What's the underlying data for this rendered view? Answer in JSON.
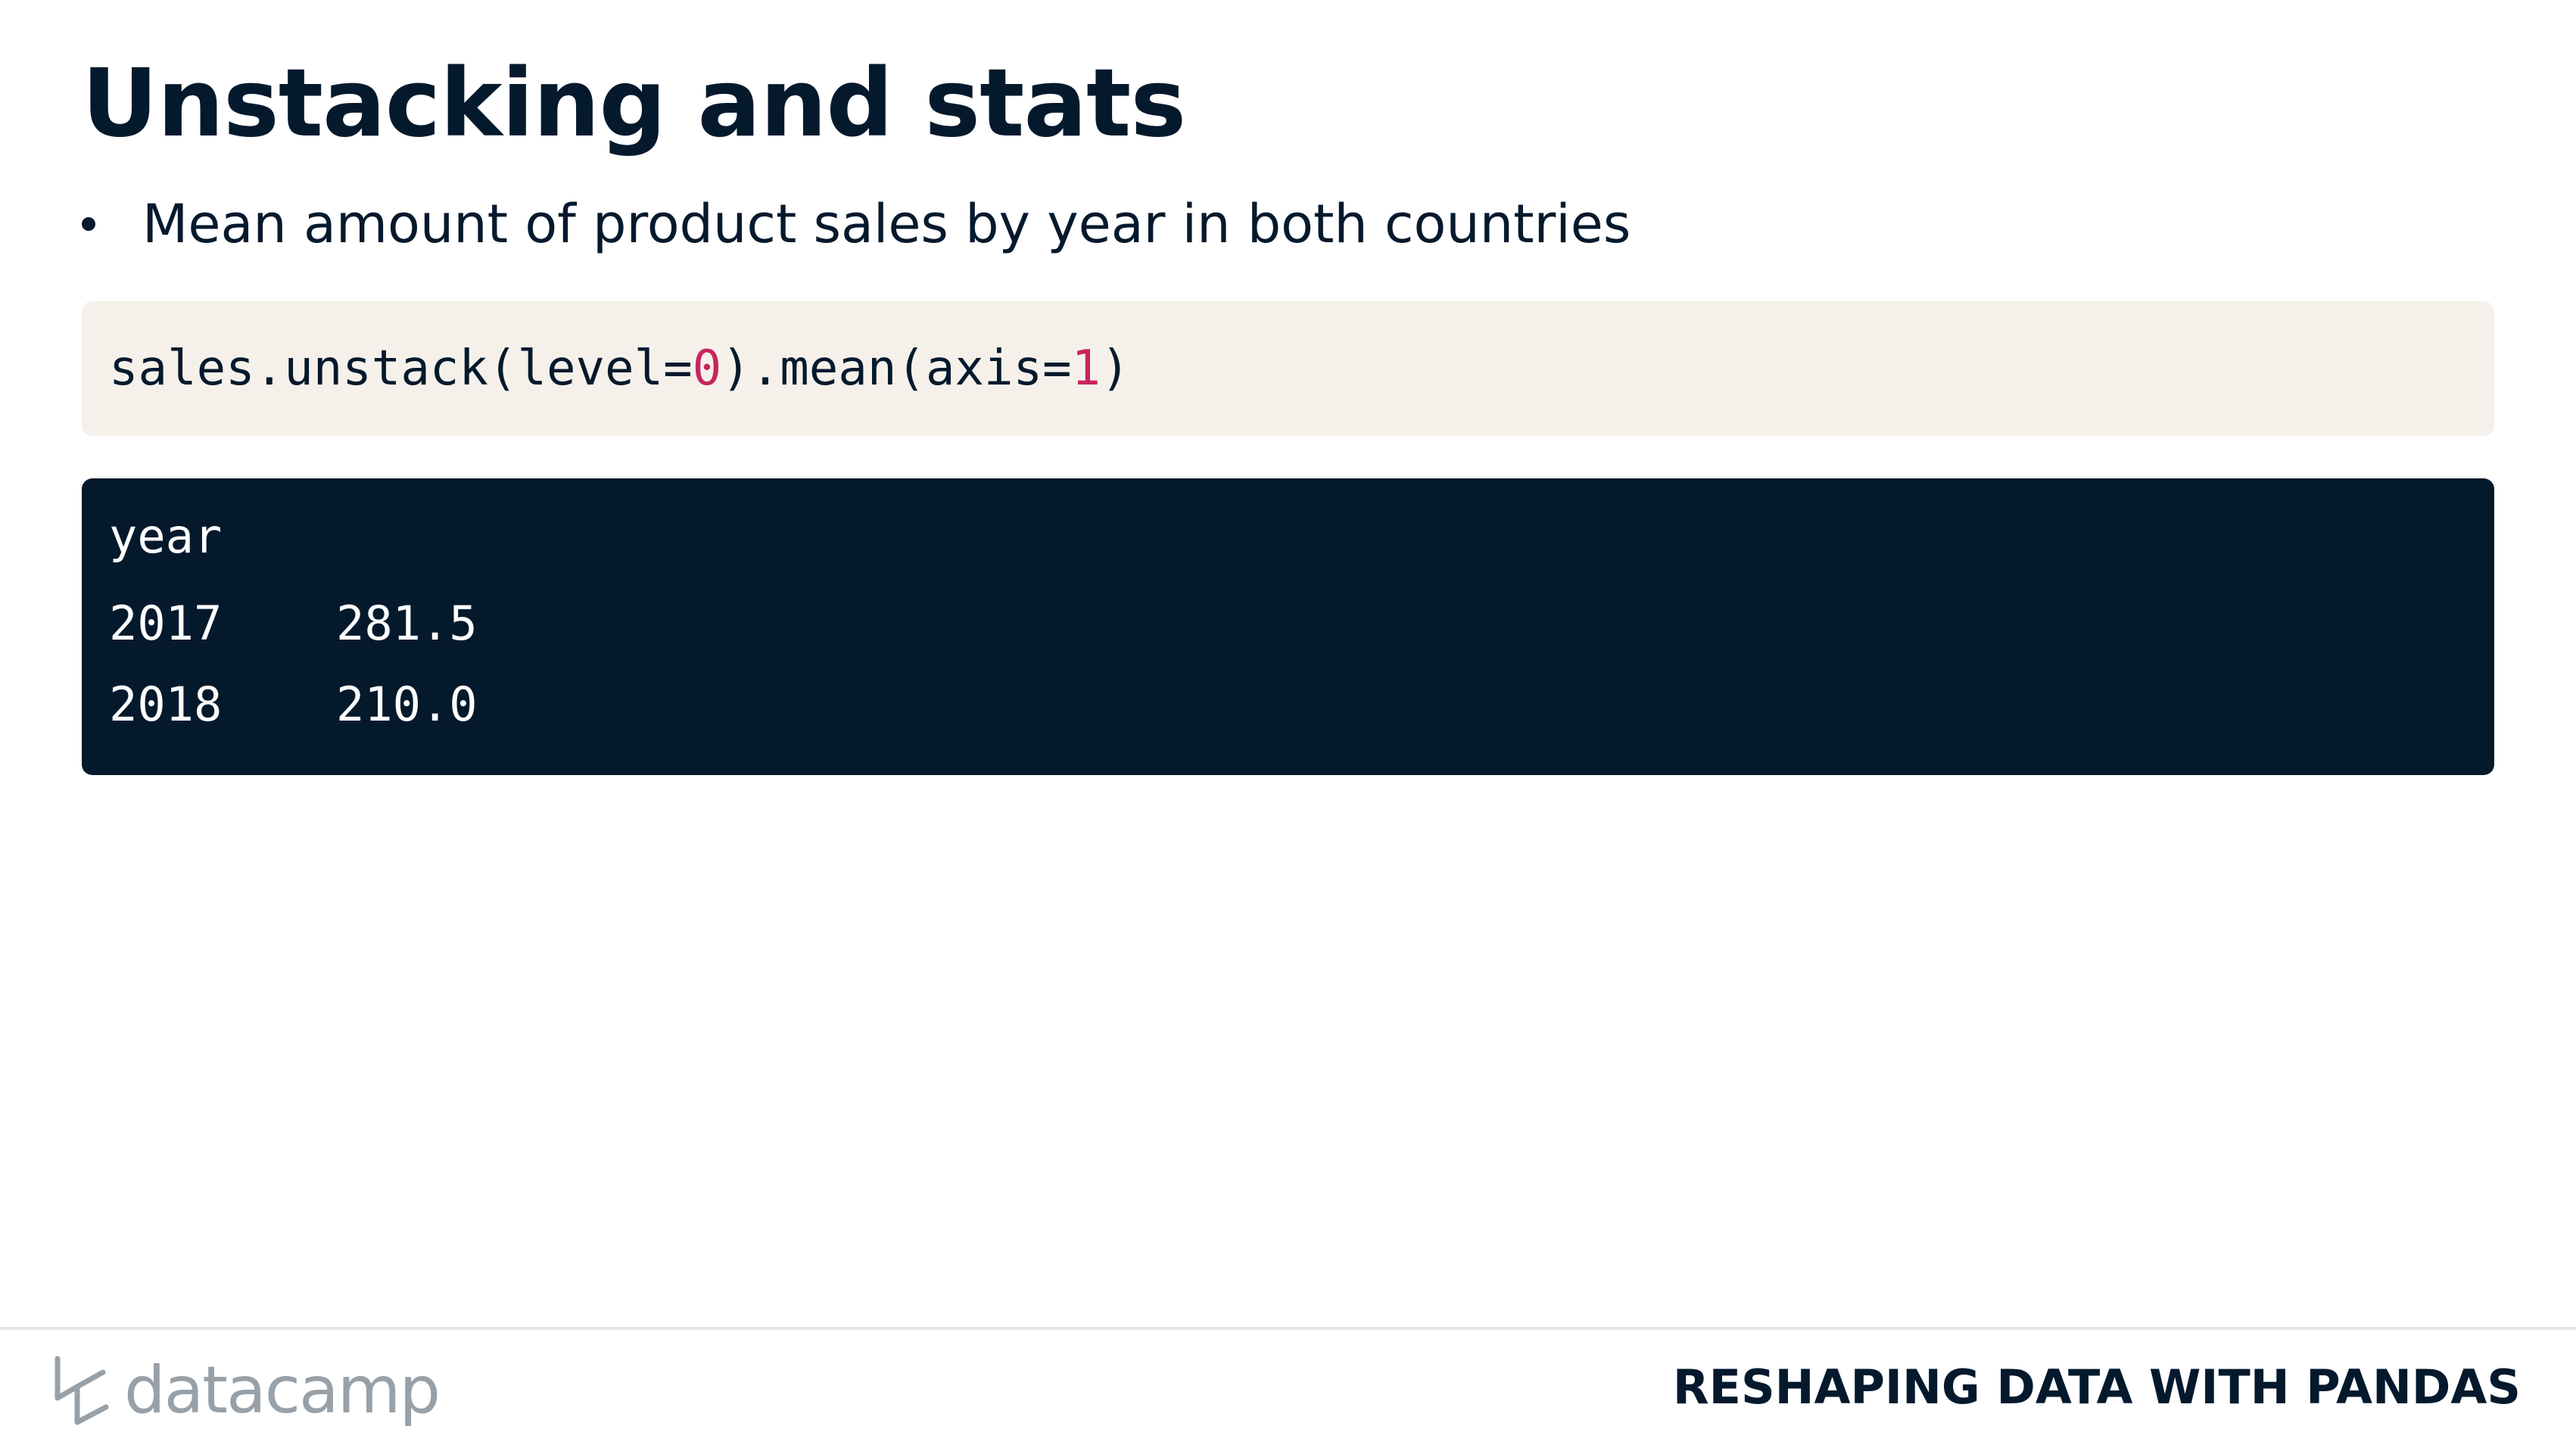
{
  "slide": {
    "title": "Unstacking and stats",
    "bullet": "Mean amount of product sales by year in both countries"
  },
  "code_input": {
    "part1": "sales.unstack(level=",
    "arg1": "0",
    "part2": ").mean(axis=",
    "arg2": "1",
    "part3": ")"
  },
  "code_output": {
    "header": "year",
    "rows": [
      {
        "year": "2017",
        "value": "281.5"
      },
      {
        "year": "2018",
        "value": "210.0"
      }
    ]
  },
  "footer": {
    "logo_text": "datacamp",
    "course_title": "RESHAPING DATA WITH PANDAS"
  },
  "colors": {
    "text": "#05192d",
    "code_bg": "#f5f1ea",
    "output_bg": "#05192d",
    "number_highlight": "#c7255f",
    "logo_gray": "#98a0a8"
  }
}
